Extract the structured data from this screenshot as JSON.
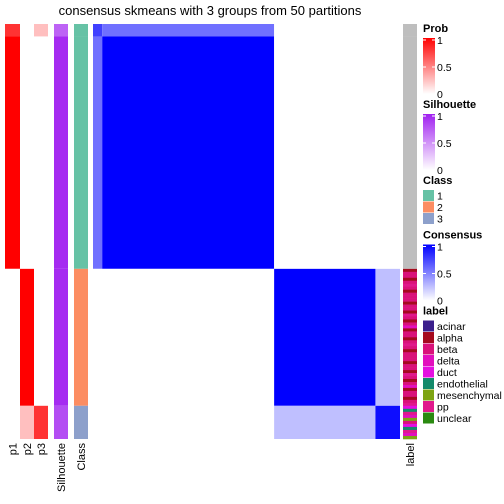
{
  "chart_data": {
    "type": "heatmap",
    "title": "consensus skmeans with 3 groups from 50 partitions",
    "n_groups": 3,
    "n_partitions": 50,
    "groups": [
      {
        "class": 1,
        "fraction": 0.59
      },
      {
        "class": 2,
        "fraction": 0.33
      },
      {
        "class": 3,
        "fraction": 0.08
      }
    ],
    "row_segments": [
      {
        "group": 1,
        "fraction": 0.03,
        "p": [
          0.8,
          0.0,
          0.25
        ],
        "silhouette": 0.7,
        "consensus_self": 0.75
      },
      {
        "group": 1,
        "fraction": 0.56,
        "p": [
          1.0,
          0.0,
          0.0
        ],
        "silhouette": 0.95,
        "consensus_self": 1.0
      },
      {
        "group": 2,
        "fraction": 0.33,
        "p": [
          0.0,
          1.0,
          0.0
        ],
        "silhouette": 0.95,
        "consensus_self": 1.0
      },
      {
        "group": 3,
        "fraction": 0.08,
        "p": [
          0.0,
          0.25,
          0.8
        ],
        "silhouette": 0.8,
        "consensus_self": 0.95
      }
    ],
    "consensus_offdiag": {
      "g2_g3": 0.25,
      "g1_other": 0.0
    },
    "annotation_columns": [
      "p1",
      "p2",
      "p3",
      "Silhouette",
      "Class"
    ],
    "right_annotation_label": "label",
    "legends": [
      {
        "title": "Prob",
        "type": "continuous",
        "ticks": [
          "1",
          "0.5",
          "0"
        ],
        "colors": [
          "#ff0000",
          "#ffffff"
        ]
      },
      {
        "title": "Silhouette",
        "type": "continuous",
        "ticks": [
          "1",
          "0.5",
          "0"
        ],
        "colors": [
          "#a020f0",
          "#ffffff"
        ]
      },
      {
        "title": "Class",
        "type": "discrete",
        "items": [
          {
            "label": "1",
            "color": "#66c2a5"
          },
          {
            "label": "2",
            "color": "#fc8d62"
          },
          {
            "label": "3",
            "color": "#8da0cb"
          }
        ]
      },
      {
        "title": "Consensus",
        "type": "continuous",
        "ticks": [
          "1",
          "0.5",
          "0"
        ],
        "colors": [
          "#0000ff",
          "#ffffff"
        ]
      },
      {
        "title": "label",
        "type": "discrete",
        "items": [
          {
            "label": "acinar",
            "color": "#3b1f8c"
          },
          {
            "label": "alpha",
            "color": "#a50a1e"
          },
          {
            "label": "beta",
            "color": "#d9127a"
          },
          {
            "label": "delta",
            "color": "#e20fbd"
          },
          {
            "label": "duct",
            "color": "#e40fe0"
          },
          {
            "label": "endothelial",
            "color": "#148a6a"
          },
          {
            "label": "mesenchymal",
            "color": "#7da413"
          },
          {
            "label": "pp",
            "color": "#e0188c"
          },
          {
            "label": "unclear",
            "color": "#2a8a10"
          }
        ]
      }
    ],
    "na_color": "#bebebe"
  }
}
